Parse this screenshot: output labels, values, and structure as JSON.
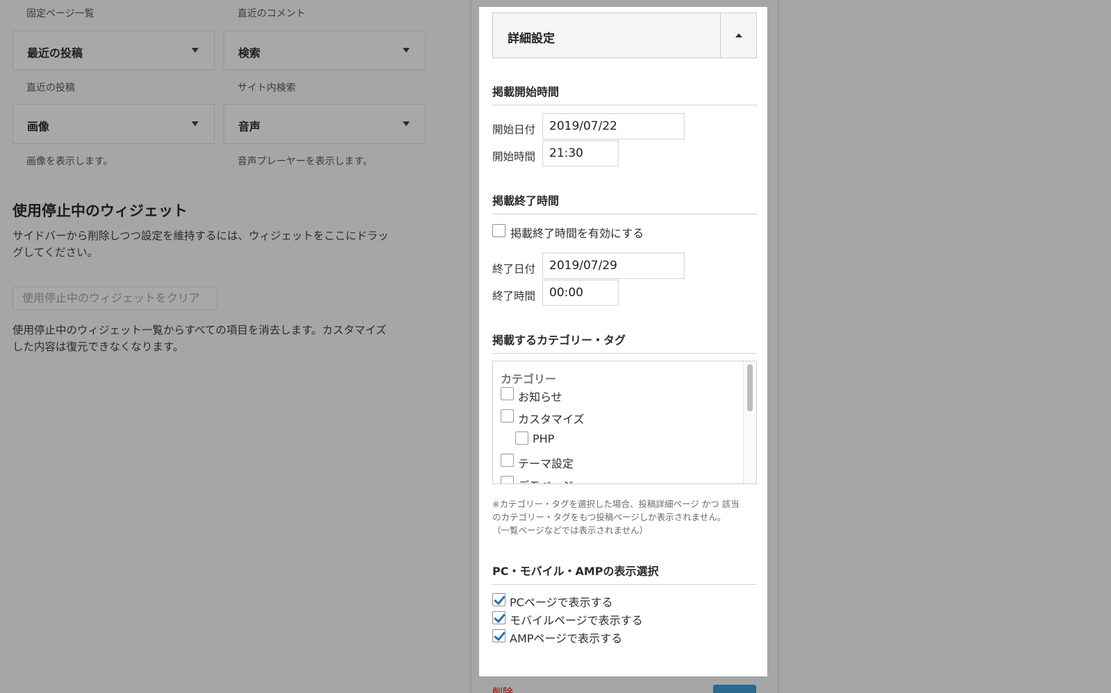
{
  "left": {
    "top_desc_1": "固定ページ一覧",
    "top_desc_2": "直近のコメント",
    "widgets": [
      {
        "title": "最近の投稿",
        "desc": "直近の投稿"
      },
      {
        "title": "検索",
        "desc": "サイト内検索"
      },
      {
        "title": "画像",
        "desc": "画像を表示します。"
      },
      {
        "title": "音声",
        "desc": "音声プレーヤーを表示します。"
      }
    ],
    "inactive_title": "使用停止中のウィジェット",
    "inactive_desc_1": "サイドバーから削除しつつ設定を維持するには、ウィジェットをここにドラッ",
    "inactive_desc_2": "グしてください。",
    "clear_button": "使用停止中のウィジェットをクリア",
    "clear_desc_1": "使用停止中のウィジェット一覧からすべての項目を消去します。カスタマイズ",
    "clear_desc_2": "した内容は復元できなくなります。"
  },
  "panel": {
    "accordion_title": "詳細設定",
    "start_section": "掲載開始時間",
    "start_date_label": "開始日付",
    "start_date_value": "2019/07/22",
    "start_time_label": "開始時間",
    "start_time_value": "21:30",
    "end_section": "掲載終了時間",
    "end_enable_label": "掲載終了時間を有効にする",
    "end_date_label": "終了日付",
    "end_date_value": "2019/07/29",
    "end_time_label": "終了時間",
    "end_time_value": "00:00",
    "category_section": "掲載するカテゴリー・タグ",
    "category_head": "カテゴリー",
    "categories": [
      "お知らせ",
      "カスタマイズ",
      "PHP",
      "テーマ設定",
      "デモページ"
    ],
    "note_1": "※カテゴリー・タグを選択した場合、投稿詳細ページ かつ 該当",
    "note_2": "のカテゴリー・タグをもつ投稿ページしか表示されません。",
    "note_3": "（一覧ページなどでは表示されません）",
    "display_section": "PC・モバイル・AMPの表示選択",
    "display_options": [
      {
        "label": "PCページで表示する",
        "checked": true
      },
      {
        "label": "モバイルページで表示する",
        "checked": true
      },
      {
        "label": "AMPページで表示する",
        "checked": true
      }
    ],
    "delete_link": "削除"
  },
  "colors": {
    "overlay_bg": "#a6a6a6",
    "panel_bg": "#ffffff",
    "check_blue": "#2271b1",
    "save_button": "#2a6a90"
  }
}
